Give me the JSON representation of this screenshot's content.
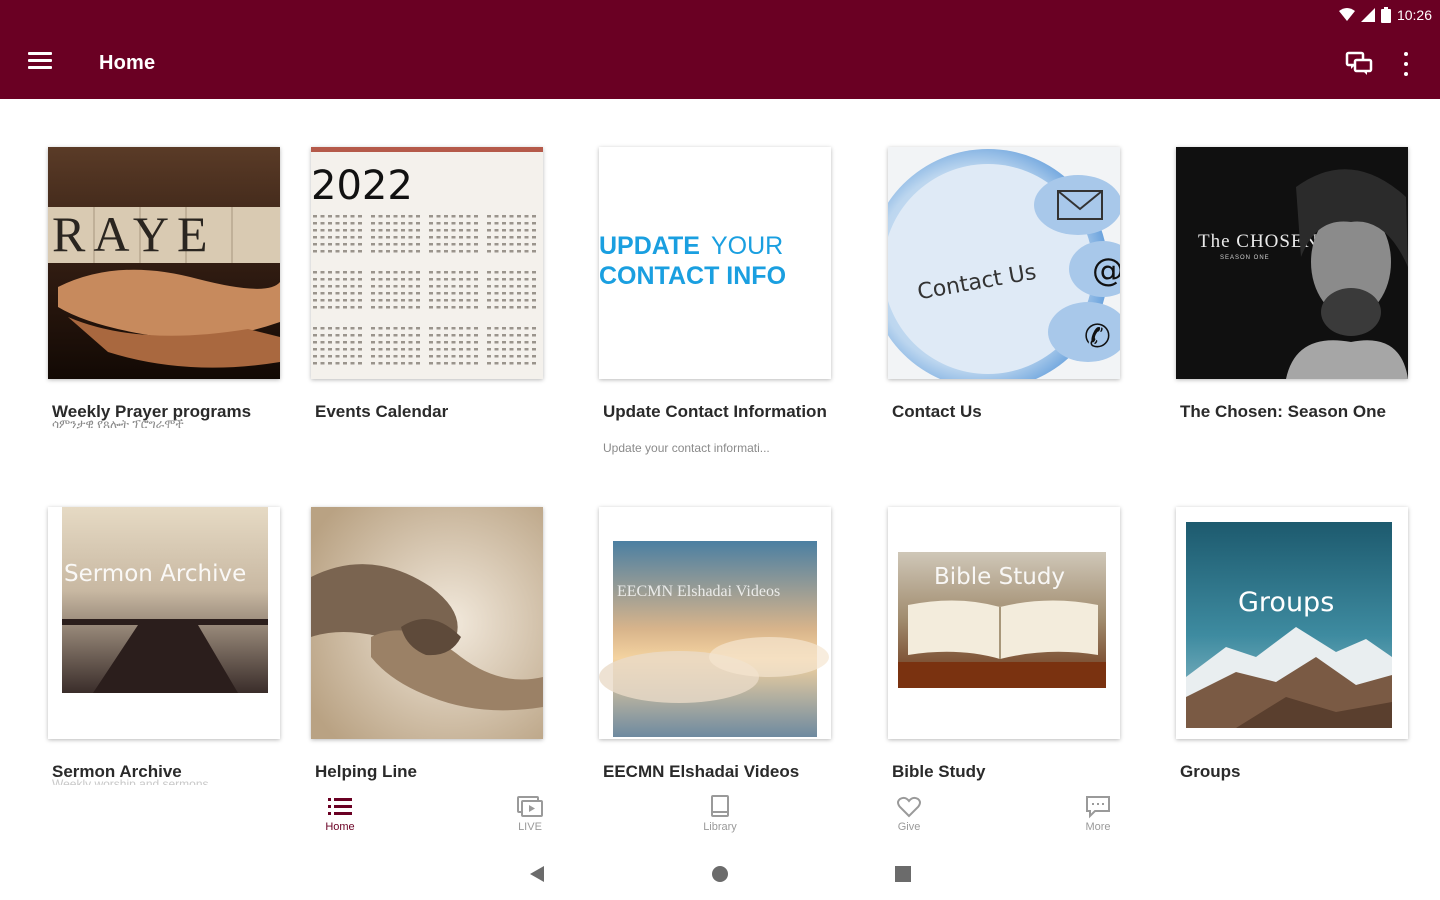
{
  "status_bar": {
    "time": "10:26"
  },
  "app_bar": {
    "title": "Home"
  },
  "colors": {
    "brand": "#6a0023",
    "active_nav": "#6a0023",
    "inactive_nav": "#9a9a9a"
  },
  "tiles": [
    {
      "title": "Weekly Prayer programs",
      "subtitle": "ሳምንታዊ የጸሎት ፕሮግራሞች",
      "image_text": "RAYE"
    },
    {
      "title": "Events Calendar",
      "subtitle": "",
      "image_text": "2022"
    },
    {
      "title": "Update Contact Information",
      "subtitle": "Update your contact informati...",
      "image_text_1": "UPDATE",
      "image_text_2": "YOUR",
      "image_text_3": "CONTACT INFO"
    },
    {
      "title": "Contact Us",
      "subtitle": "",
      "image_text": "Contact Us"
    },
    {
      "title": "The Chosen: Season One",
      "subtitle": "",
      "image_text": "The CHOSEN",
      "image_text_small": "SEASON ONE"
    },
    {
      "title": "Sermon Archive",
      "subtitle": "Weekly worship and sermons",
      "image_text": "Sermon Archive"
    },
    {
      "title": "Helping Line",
      "subtitle": "",
      "image_text": ""
    },
    {
      "title": "EECMN Elshadai Videos",
      "subtitle": "",
      "image_text": "EECMN Elshadai Videos"
    },
    {
      "title": "Bible Study",
      "subtitle": "",
      "image_text": "Bible Study"
    },
    {
      "title": "Groups",
      "subtitle": "",
      "image_text": "Groups"
    }
  ],
  "bottom_nav": [
    {
      "label": "Home",
      "icon": "list-icon",
      "active": true
    },
    {
      "label": "LIVE",
      "icon": "live-video-icon",
      "active": false
    },
    {
      "label": "Library",
      "icon": "book-icon",
      "active": false
    },
    {
      "label": "Give",
      "icon": "heart-icon",
      "active": false
    },
    {
      "label": "More",
      "icon": "chat-bubble-icon",
      "active": false
    }
  ],
  "system_nav": [
    "back-icon",
    "home-circle-icon",
    "recents-square-icon"
  ]
}
